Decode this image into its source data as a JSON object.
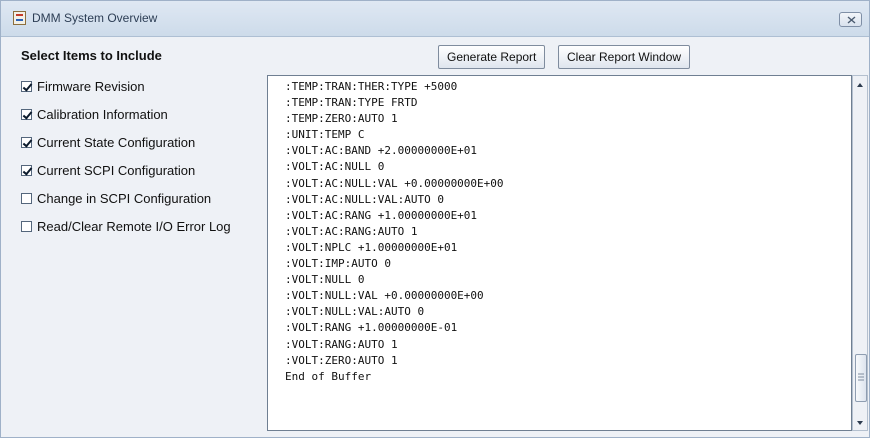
{
  "window": {
    "title": "DMM System Overview",
    "close_icon": "close-icon",
    "app_icon": "java-cup-icon"
  },
  "toolbar": {
    "heading": "Select Items to Include",
    "generate_label": "Generate Report",
    "clear_label": "Clear Report Window"
  },
  "options": [
    {
      "label": "Firmware Revision",
      "checked": true
    },
    {
      "label": "Calibration Information",
      "checked": true
    },
    {
      "label": "Current State Configuration",
      "checked": true
    },
    {
      "label": "Current SCPI Configuration",
      "checked": true
    },
    {
      "label": "Change in SCPI Configuration",
      "checked": false
    },
    {
      "label": "Read/Clear Remote I/O Error Log",
      "checked": false
    }
  ],
  "report": {
    "lines": [
      ":TEMP:TRAN:THER:TYPE +5000",
      ":TEMP:TRAN:TYPE FRTD",
      ":TEMP:ZERO:AUTO 1",
      ":UNIT:TEMP C",
      ":VOLT:AC:BAND +2.00000000E+01",
      ":VOLT:AC:NULL 0",
      ":VOLT:AC:NULL:VAL +0.00000000E+00",
      ":VOLT:AC:NULL:VAL:AUTO 0",
      ":VOLT:AC:RANG +1.00000000E+01",
      ":VOLT:AC:RANG:AUTO 1",
      ":VOLT:NPLC +1.00000000E+01",
      ":VOLT:IMP:AUTO 0",
      ":VOLT:NULL 0",
      ":VOLT:NULL:VAL +0.00000000E+00",
      ":VOLT:NULL:VAL:AUTO 0",
      ":VOLT:RANG +1.00000000E-01",
      ":VOLT:RANG:AUTO 1",
      ":VOLT:ZERO:AUTO 1",
      "End of Buffer"
    ],
    "scroll_position": 0.95
  }
}
